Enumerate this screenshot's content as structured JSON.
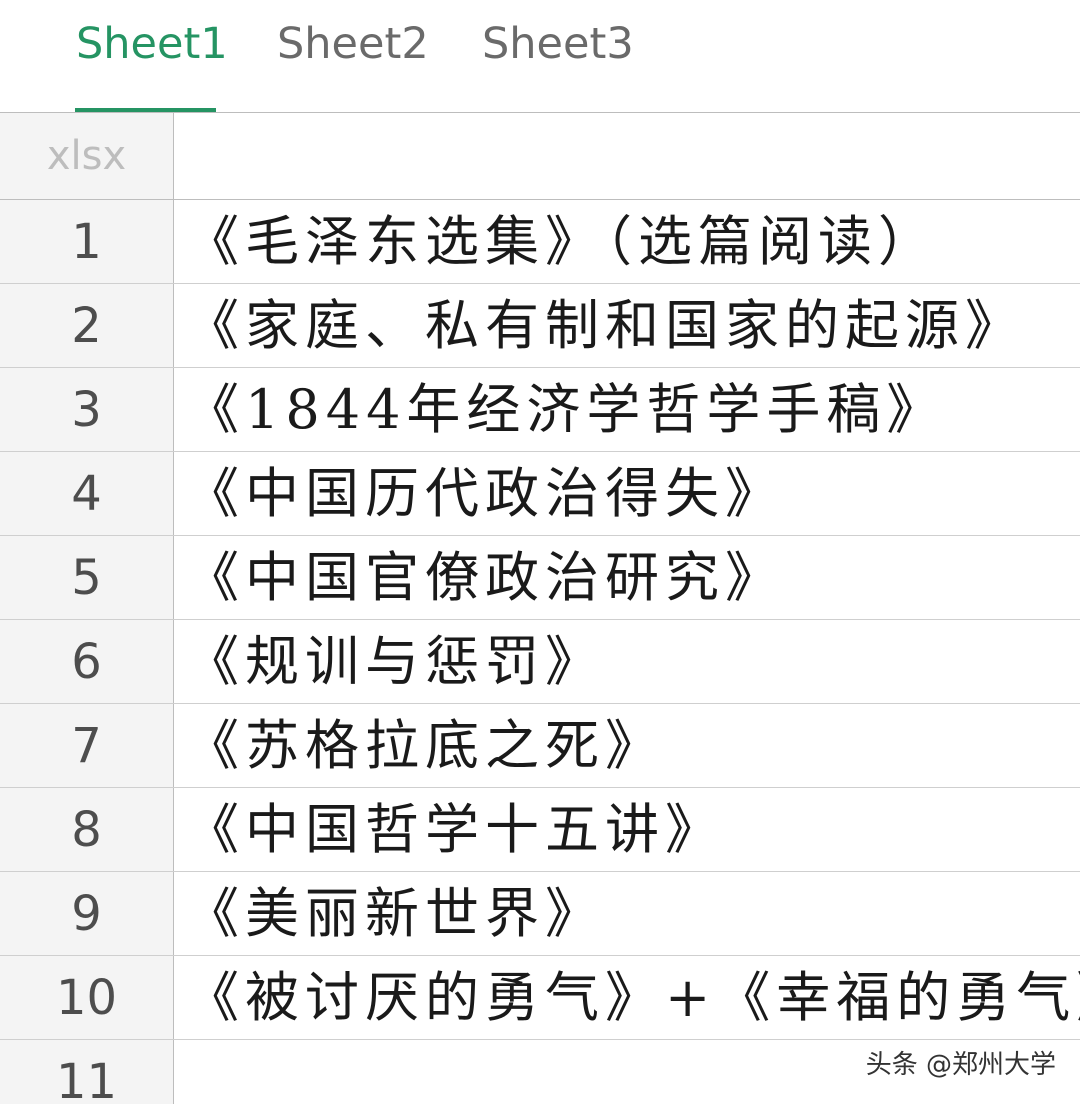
{
  "tabs": [
    {
      "label": "Sheet1",
      "active": true
    },
    {
      "label": "Sheet2",
      "active": false
    },
    {
      "label": "Sheet3",
      "active": false
    }
  ],
  "colors": {
    "accent": "#259463"
  },
  "corner_label": "xlsx",
  "rows": [
    {
      "number": "1",
      "text": "《毛泽东选集》（选篇阅读）"
    },
    {
      "number": "2",
      "text": "《家庭、私有制和国家的起源》"
    },
    {
      "number": "3",
      "text": "《1844年经济学哲学手稿》"
    },
    {
      "number": "4",
      "text": "《中国历代政治得失》"
    },
    {
      "number": "5",
      "text": "《中国官僚政治研究》"
    },
    {
      "number": "6",
      "text": "《规训与惩罚》"
    },
    {
      "number": "7",
      "text": "《苏格拉底之死》"
    },
    {
      "number": "8",
      "text": "《中国哲学十五讲》"
    },
    {
      "number": "9",
      "text": "《美丽新世界》"
    },
    {
      "number": "10",
      "text": "《被讨厌的勇气》+《幸福的勇气》"
    },
    {
      "number": "11",
      "text": ""
    }
  ],
  "watermark": "头条 @郑州大学"
}
